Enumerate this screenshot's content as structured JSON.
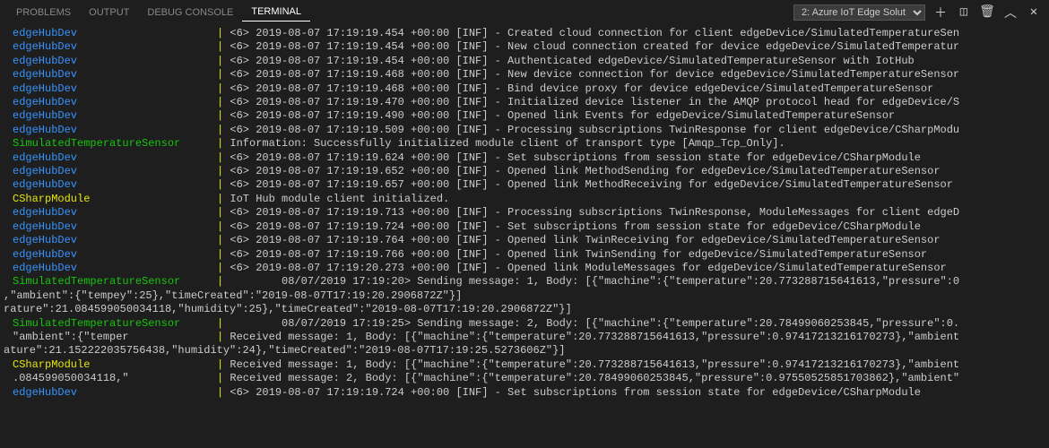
{
  "tabs": {
    "problems": "PROBLEMS",
    "output": "OUTPUT",
    "debug_console": "DEBUG CONSOLE",
    "terminal": "TERMINAL"
  },
  "terminal_selector": "2: Azure IoT Edge Solut",
  "lines": [
    {
      "t": "log",
      "src": "edgeHubDev",
      "cls": "src-blue",
      "msg": " <6> 2019-08-07 17:19:19.454 +00:00 [INF] - Created cloud connection for client edgeDevice/SimulatedTemperatureSen"
    },
    {
      "t": "log",
      "src": "edgeHubDev",
      "cls": "src-blue",
      "msg": " <6> 2019-08-07 17:19:19.454 +00:00 [INF] - New cloud connection created for device edgeDevice/SimulatedTemperatur"
    },
    {
      "t": "log",
      "src": "edgeHubDev",
      "cls": "src-blue",
      "msg": " <6> 2019-08-07 17:19:19.454 +00:00 [INF] - Authenticated edgeDevice/SimulatedTemperatureSensor with IotHub"
    },
    {
      "t": "log",
      "src": "edgeHubDev",
      "cls": "src-blue",
      "msg": " <6> 2019-08-07 17:19:19.468 +00:00 [INF] - New device connection for device edgeDevice/SimulatedTemperatureSensor"
    },
    {
      "t": "log",
      "src": "edgeHubDev",
      "cls": "src-blue",
      "msg": " <6> 2019-08-07 17:19:19.468 +00:00 [INF] - Bind device proxy for device edgeDevice/SimulatedTemperatureSensor"
    },
    {
      "t": "log",
      "src": "edgeHubDev",
      "cls": "src-blue",
      "msg": " <6> 2019-08-07 17:19:19.470 +00:00 [INF] - Initialized device listener in the AMQP protocol head for edgeDevice/S"
    },
    {
      "t": "log",
      "src": "edgeHubDev",
      "cls": "src-blue",
      "msg": " <6> 2019-08-07 17:19:19.490 +00:00 [INF] - Opened link Events for edgeDevice/SimulatedTemperatureSensor"
    },
    {
      "t": "log",
      "src": "edgeHubDev",
      "cls": "src-blue",
      "msg": " <6> 2019-08-07 17:19:19.509 +00:00 [INF] - Processing subscriptions TwinResponse for client edgeDevice/CSharpModu"
    },
    {
      "t": "log",
      "src": "SimulatedTemperatureSensor",
      "cls": "src-green",
      "msg": " Information: Successfully initialized module client of transport type [Amqp_Tcp_Only]."
    },
    {
      "t": "log",
      "src": "edgeHubDev",
      "cls": "src-blue",
      "msg": " <6> 2019-08-07 17:19:19.624 +00:00 [INF] - Set subscriptions from session state for edgeDevice/CSharpModule"
    },
    {
      "t": "log",
      "src": "edgeHubDev",
      "cls": "src-blue",
      "msg": " <6> 2019-08-07 17:19:19.652 +00:00 [INF] - Opened link MethodSending for edgeDevice/SimulatedTemperatureSensor"
    },
    {
      "t": "log",
      "src": "edgeHubDev",
      "cls": "src-blue",
      "msg": " <6> 2019-08-07 17:19:19.657 +00:00 [INF] - Opened link MethodReceiving for edgeDevice/SimulatedTemperatureSensor"
    },
    {
      "t": "log",
      "src": "CSharpModule",
      "cls": "src-yellow",
      "msg": " IoT Hub module client initialized."
    },
    {
      "t": "log",
      "src": "edgeHubDev",
      "cls": "src-blue",
      "msg": " <6> 2019-08-07 17:19:19.713 +00:00 [INF] - Processing subscriptions TwinResponse, ModuleMessages for client edgeD"
    },
    {
      "t": "log",
      "src": "edgeHubDev",
      "cls": "src-blue",
      "msg": " <6> 2019-08-07 17:19:19.724 +00:00 [INF] - Set subscriptions from session state for edgeDevice/CSharpModule"
    },
    {
      "t": "log",
      "src": "edgeHubDev",
      "cls": "src-blue",
      "msg": " <6> 2019-08-07 17:19:19.764 +00:00 [INF] - Opened link TwinReceiving for edgeDevice/SimulatedTemperatureSensor"
    },
    {
      "t": "log",
      "src": "edgeHubDev",
      "cls": "src-blue",
      "msg": " <6> 2019-08-07 17:19:19.766 +00:00 [INF] - Opened link TwinSending for edgeDevice/SimulatedTemperatureSensor"
    },
    {
      "t": "log",
      "src": "edgeHubDev",
      "cls": "src-blue",
      "msg": " <6> 2019-08-07 17:19:20.273 +00:00 [INF] - Opened link ModuleMessages for edgeDevice/SimulatedTemperatureSensor"
    },
    {
      "t": "log",
      "src": "SimulatedTemperatureSensor",
      "cls": "src-green",
      "msg": "         08/07/2019 17:19:20> Sending message: 1, Body: [{\"machine\":{\"temperature\":20.773288715641613,\"pressure\":0"
    },
    {
      "t": "wrap",
      "text": ",\"ambient\":{\"tempey\":25},\"timeCreated\":\"2019-08-07T17:19:20.2906872Z\"}]"
    },
    {
      "t": "wrap",
      "text": "rature\":21.084599050034118,\"humidity\":25},\"timeCreated\":\"2019-08-07T17:19:20.2906872Z\"}]"
    },
    {
      "t": "log",
      "src": "SimulatedTemperatureSensor",
      "cls": "src-green",
      "msg": "         08/07/2019 17:19:25> Sending message: 2, Body: [{\"machine\":{\"temperature\":20.78499060253845,\"pressure\":0."
    },
    {
      "t": "log",
      "src": "\"ambient\":{\"temper",
      "cls": "",
      "msg": " Received message: 1, Body: [{\"machine\":{\"temperature\":20.773288715641613,\"pressure\":0.97417213216170273},\"ambient"
    },
    {
      "t": "wrap",
      "text": "ature\":21.152222035756438,\"humidity\":24},\"timeCreated\":\"2019-08-07T17:19:25.5273606Z\"}]"
    },
    {
      "t": "log",
      "src": "CSharpModule",
      "cls": "src-yellow",
      "msg": " Received message: 1, Body: [{\"machine\":{\"temperature\":20.773288715641613,\"pressure\":0.97417213216170273},\"ambient"
    },
    {
      "t": "log",
      "src": ".084599050034118,\"",
      "cls": "",
      "msg": " Received message: 2, Body: [{\"machine\":{\"temperature\":20.78499060253845,\"pressure\":0.97550525851703862},\"ambient\""
    },
    {
      "t": "log",
      "src": "edgeHubDev",
      "cls": "src-blue",
      "msg": " <6> 2019-08-07 17:19:19.724 +00:00 [INF] - Set subscriptions from session state for edgeDevice/CSharpModule"
    }
  ]
}
